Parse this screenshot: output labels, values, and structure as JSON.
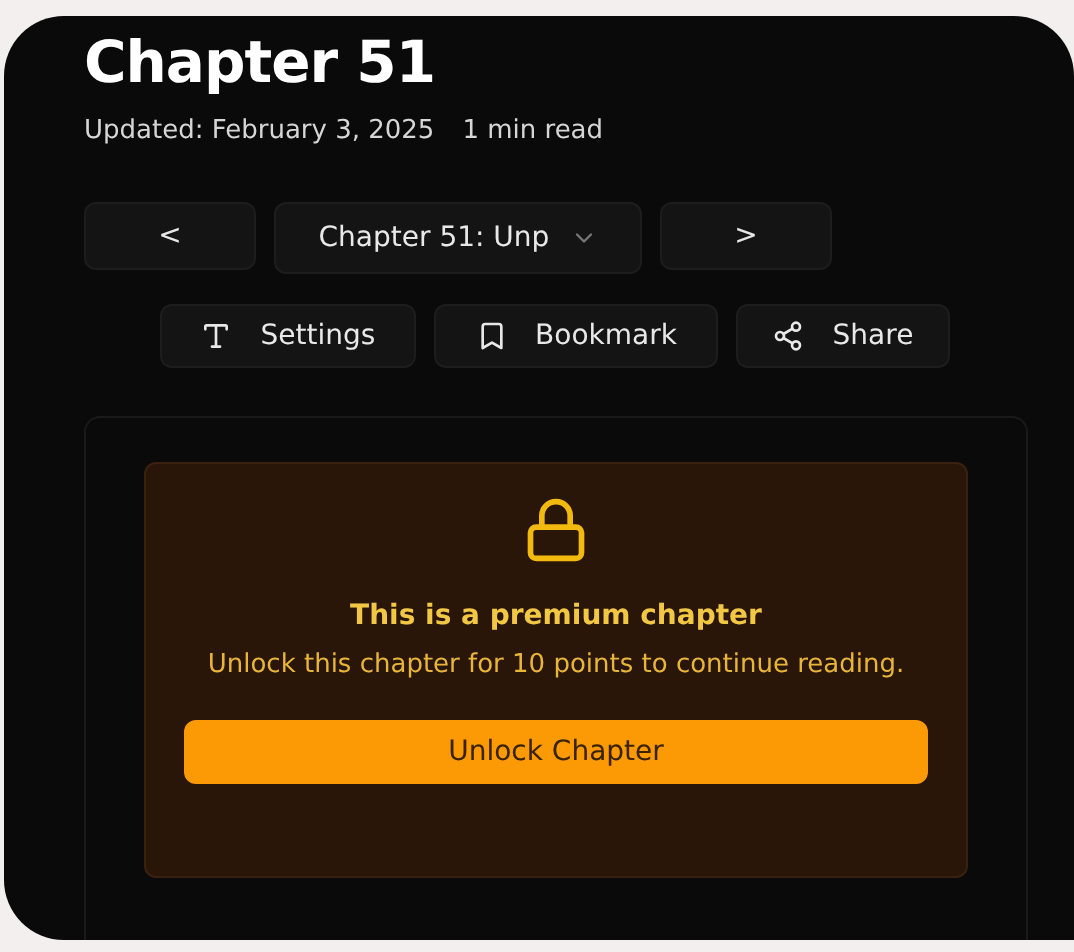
{
  "title": "Chapter 51",
  "meta": [
    "Updated: February 3, 2025",
    "1 min read"
  ],
  "nav": {
    "prev": "<",
    "chapter_select": "Chapter 51: Unp",
    "next": ">"
  },
  "actions": [
    {
      "kind": "settings",
      "label": "Settings"
    },
    {
      "kind": "bookmark",
      "label": "Bookmark"
    },
    {
      "kind": "share",
      "label": "Share"
    }
  ],
  "premium": {
    "heading": "This is a premium chapter",
    "message": "Unlock this chapter for 10 points to continue reading.",
    "button": "Unlock Chapter"
  }
}
